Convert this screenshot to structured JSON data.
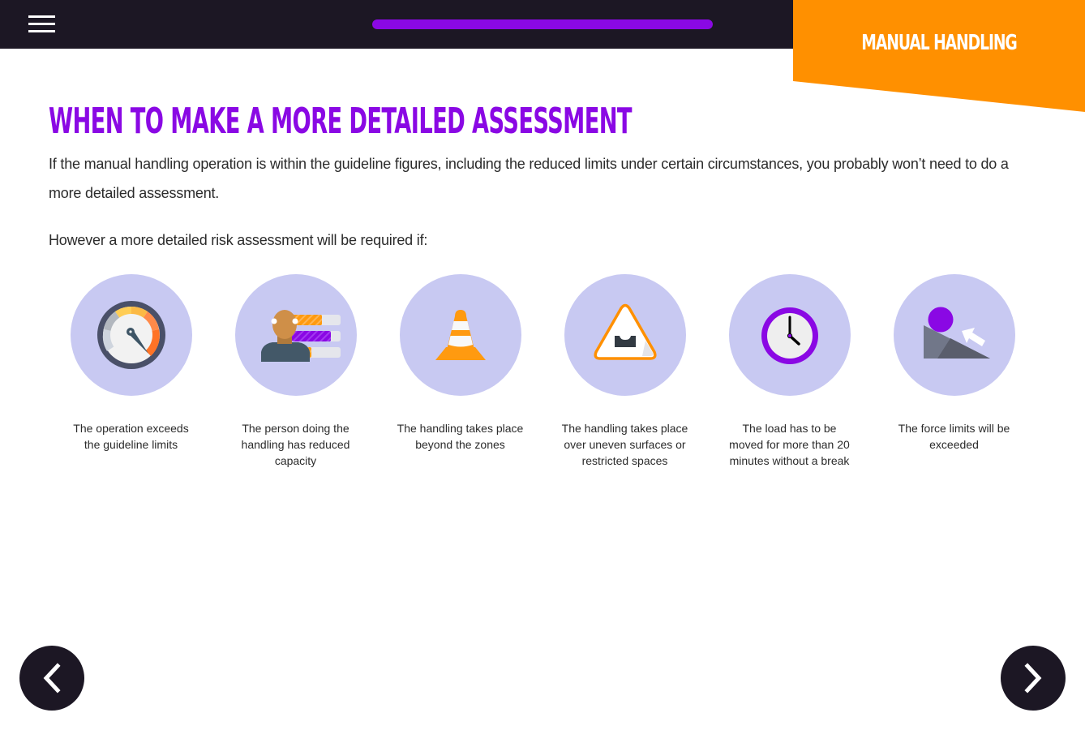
{
  "header": {
    "menu_icon": "hamburger-menu-icon",
    "progress": {
      "value_percent": 100,
      "color": "#8a08e4"
    },
    "course_title": "Manual Handling",
    "course_tag_color": "#ff9000"
  },
  "main": {
    "title": "When to make a more detailed assessment",
    "intro": "If the manual handling operation is within the guideline figures, including the reduced limits under certain circumstances, you probably won’t need to do a more detailed assessment.",
    "lead": "However a more detailed risk assessment will be required if:",
    "items": [
      {
        "icon": "speedometer-icon",
        "caption": "The operation exceeds the guideline limits"
      },
      {
        "icon": "person-capacity-icon",
        "caption": "The person doing the handling has reduced capacity"
      },
      {
        "icon": "traffic-cone-icon",
        "caption": "The handling takes place beyond the zones"
      },
      {
        "icon": "uneven-road-warning-icon",
        "caption": "The handling takes place over uneven surfaces or restricted spaces"
      },
      {
        "icon": "clock-icon",
        "caption": "The load has to be moved for more than 20 minutes without a break"
      },
      {
        "icon": "force-slope-icon",
        "caption": "The force limits will be exceeded"
      }
    ]
  },
  "navigation": {
    "prev_icon": "chevron-left-icon",
    "next_icon": "chevron-right-icon"
  },
  "colors": {
    "accent_purple": "#8a08e4",
    "accent_orange": "#ff9000",
    "dark": "#1c1724",
    "icon_circle": "#c8c9f2"
  }
}
